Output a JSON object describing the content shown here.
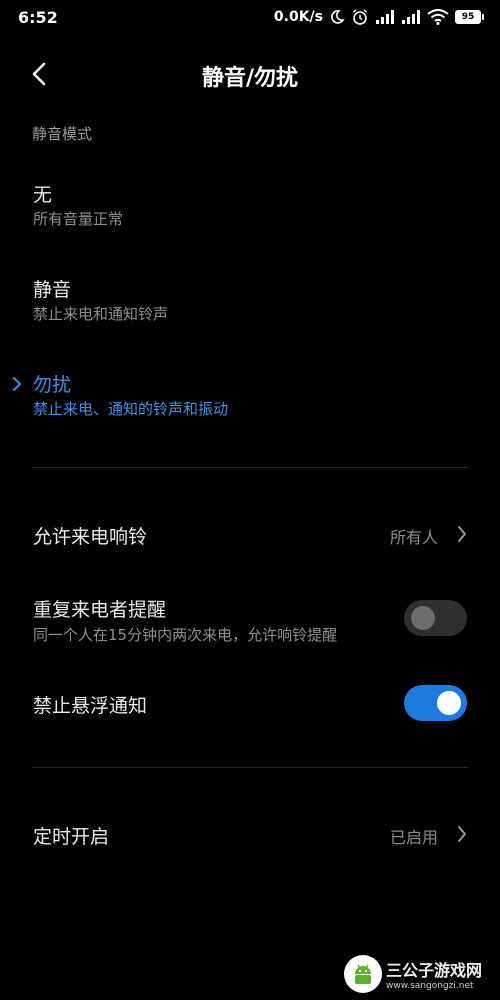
{
  "status_bar": {
    "time": "6:52",
    "net_speed": "0.0K/s",
    "battery": "95"
  },
  "header": {
    "title": "静音/勿扰"
  },
  "mute_section": {
    "label": "静音模式",
    "modes": [
      {
        "title": "无",
        "desc": "所有音量正常",
        "selected": false
      },
      {
        "title": "静音",
        "desc": "禁止来电和通知铃声",
        "selected": false
      },
      {
        "title": "勿扰",
        "desc": "禁止来电、通知的铃声和振动",
        "selected": true
      }
    ]
  },
  "settings": {
    "allow_calls": {
      "title": "允许来电响铃",
      "value": "所有人"
    },
    "repeat_callers": {
      "title": "重复来电者提醒",
      "desc": "同一个人在15分钟内两次来电，允许响铃提醒",
      "enabled": false
    },
    "block_floating": {
      "title": "禁止悬浮通知",
      "enabled": true
    },
    "schedule": {
      "title": "定时开启",
      "value": "已启用"
    }
  },
  "watermark": {
    "title": "三公子游戏网",
    "url": "www.sangongzi.net"
  },
  "colors": {
    "background": "#000000",
    "accent": "#3f8fe6",
    "toggle_on": "#1f7ae0"
  }
}
